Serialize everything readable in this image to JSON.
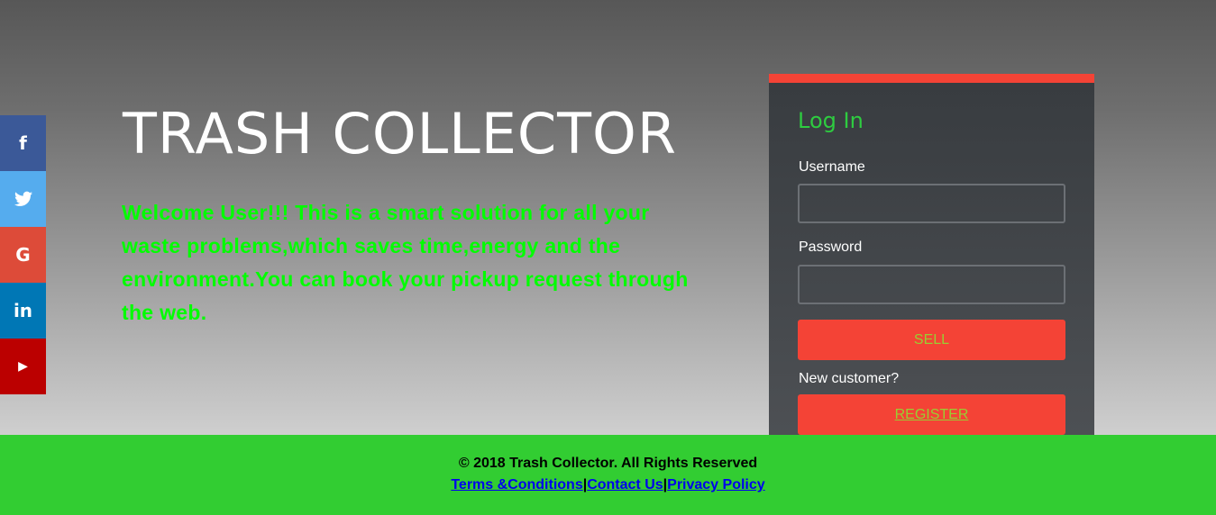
{
  "hero": {
    "title": "TRASH COLLECTOR",
    "welcome": "Welcome User!!! This is a smart solution for all your waste problems,which saves time,energy and the environment.You can book your pickup request through the web."
  },
  "social": [
    {
      "name": "facebook-icon",
      "glyph": "f"
    },
    {
      "name": "twitter-icon",
      "glyph": "🐦"
    },
    {
      "name": "google-icon",
      "glyph": "G"
    },
    {
      "name": "linkedin-icon",
      "glyph": "in"
    },
    {
      "name": "youtube-icon",
      "glyph": "▶"
    }
  ],
  "login": {
    "heading": "Log In",
    "username_label": "Username",
    "username_value": "",
    "password_label": "Password",
    "password_value": "",
    "sell_label": "SELL",
    "new_customer": "New customer?",
    "register_label": "REGISTER"
  },
  "footer": {
    "copyright": "© 2018 Trash Collector. All Rights Reserved",
    "links": [
      "Terms &Conditions",
      "Contact Us",
      "Privacy Policy"
    ],
    "separator": "|"
  },
  "colors": {
    "accent_red": "#f44336",
    "footer_green": "#32cd32",
    "welcome_green": "#00ff00",
    "heading_green": "#2ecc40"
  }
}
